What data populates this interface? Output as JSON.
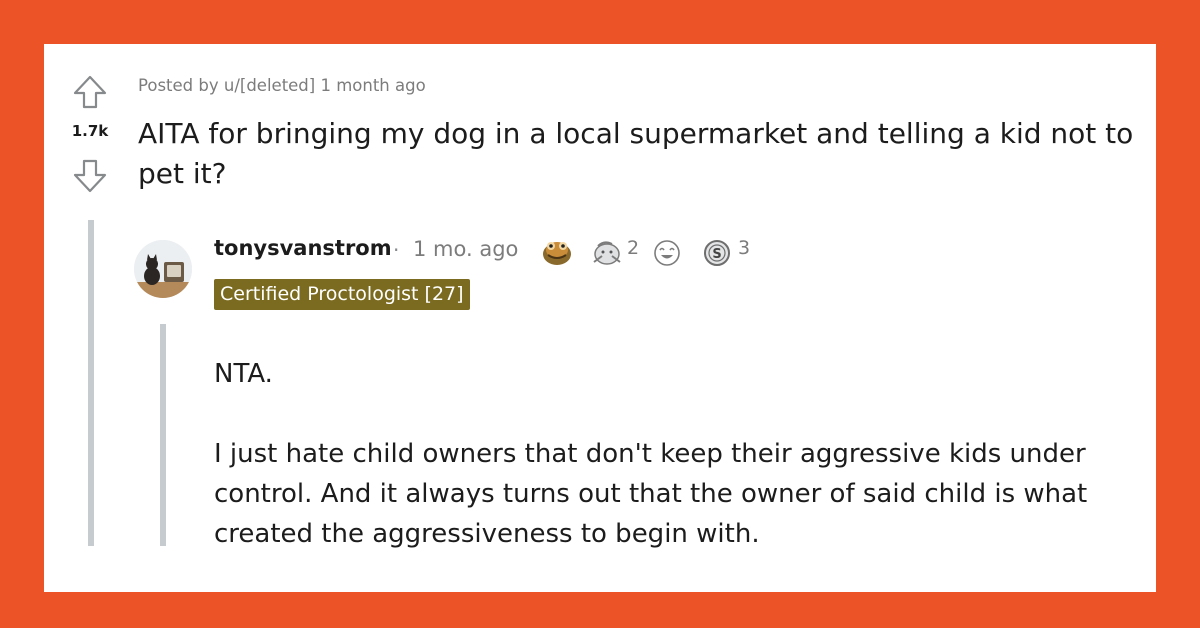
{
  "post": {
    "score": "1.7k",
    "posted_by": "Posted by u/[deleted] 1 month ago",
    "title": "AITA for bringing my dog in a local supermarket and telling a kid not to pet it?"
  },
  "comment": {
    "username": "tonysvanstrom",
    "separator": "·",
    "time": "1 mo. ago",
    "flair": "Certified Proctologist [27]",
    "flair_color": "#7a6b20",
    "awards": [
      {
        "icon": "frog-hug-award-icon",
        "count": ""
      },
      {
        "icon": "wholesome-seal-award-icon",
        "count": "2"
      },
      {
        "icon": "laughing-face-award-icon",
        "count": ""
      },
      {
        "icon": "silver-coin-award-icon",
        "count": "3"
      }
    ],
    "paragraphs": [
      "NTA.",
      "I just hate child owners that don't keep their aggressive kids under control. And it always turns out that the owner of said child is what created the aggressiveness to begin with."
    ]
  },
  "colors": {
    "background": "#ec5327",
    "card": "#ffffff",
    "thread_line": "#c6cbcf"
  }
}
